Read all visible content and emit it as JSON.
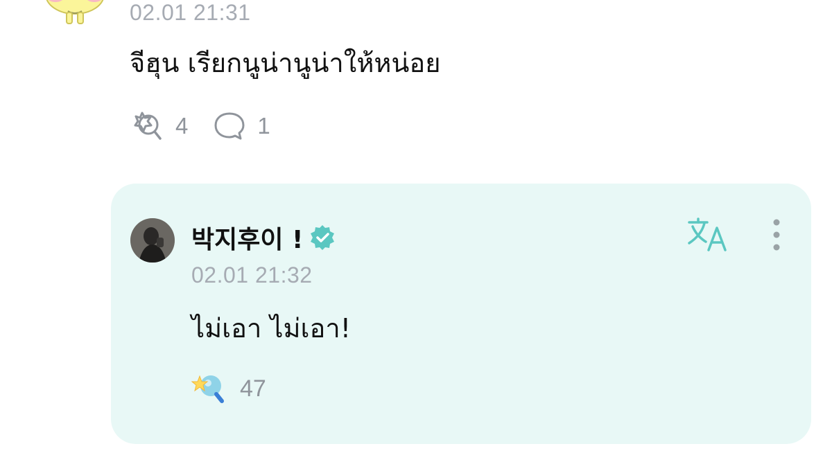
{
  "parent_comment": {
    "avatar_icon": "yellow-character-avatar",
    "timestamp": "02.01 21:31",
    "body": "จีฮุน เรียกนูน่านูน่าให้หน่อย",
    "reaction_icon": "reaction-outline-icon",
    "reaction_count": "4",
    "reply_icon": "speech-bubble-icon",
    "reply_count": "1"
  },
  "reply": {
    "author_name": "박지후이 !",
    "verified_icon": "verified-badge-icon",
    "verified_color": "#5bc7c1",
    "timestamp": "02.01 21:32",
    "body": "ไม่เอา ไม่เอา!",
    "translate_icon": "translate-icon",
    "more_icon": "more-vertical-icon",
    "reaction_icon": "star-reaction-icon",
    "reaction_count": "47",
    "card_color": "#e8f8f6",
    "accent_color": "#5bc7c1"
  }
}
